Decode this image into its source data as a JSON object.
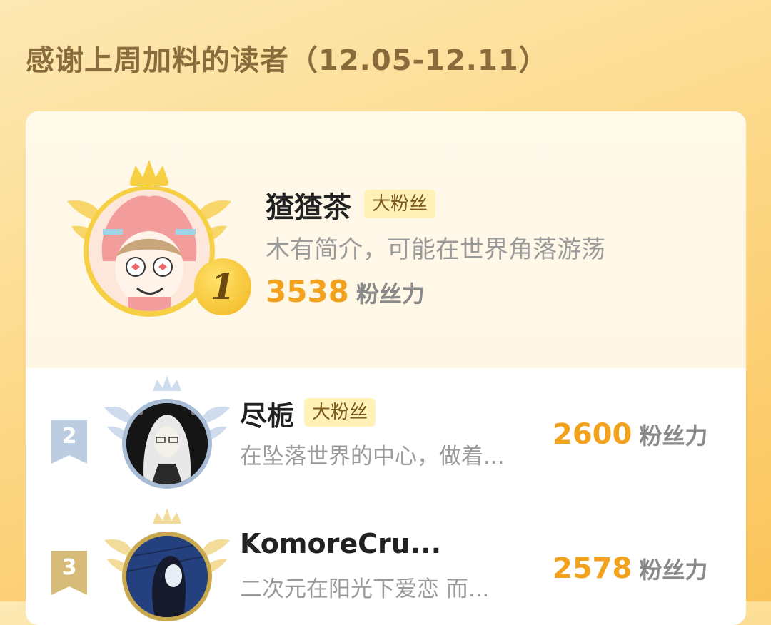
{
  "header": {
    "title": "感谢上周加料的读者（12.05-12.11）"
  },
  "colors": {
    "accent": "#f2a21c",
    "badge_bg": "#fff1b8",
    "gold": "#f5c330",
    "silver": "#b8c9e0",
    "bronze": "#d6b970"
  },
  "readers": [
    {
      "rank": "1",
      "name": "猹猹茶",
      "badge": "大粉丝",
      "bio": "木有简介，可能在世界角落游荡",
      "score": "3538",
      "score_unit": "粉丝力",
      "crown_icon": "gold-crown-icon"
    },
    {
      "rank": "2",
      "name": "尽栀",
      "badge": "大粉丝",
      "bio": "在坠落世界的中心，做着...",
      "score": "2600",
      "score_unit": "粉丝力",
      "crown_icon": "silver-crown-icon"
    },
    {
      "rank": "3",
      "name": "KomoreCru...",
      "badge": "",
      "bio": "二次元在阳光下爱恋 而...",
      "score": "2578",
      "score_unit": "粉丝力",
      "crown_icon": "bronze-crown-icon"
    }
  ]
}
